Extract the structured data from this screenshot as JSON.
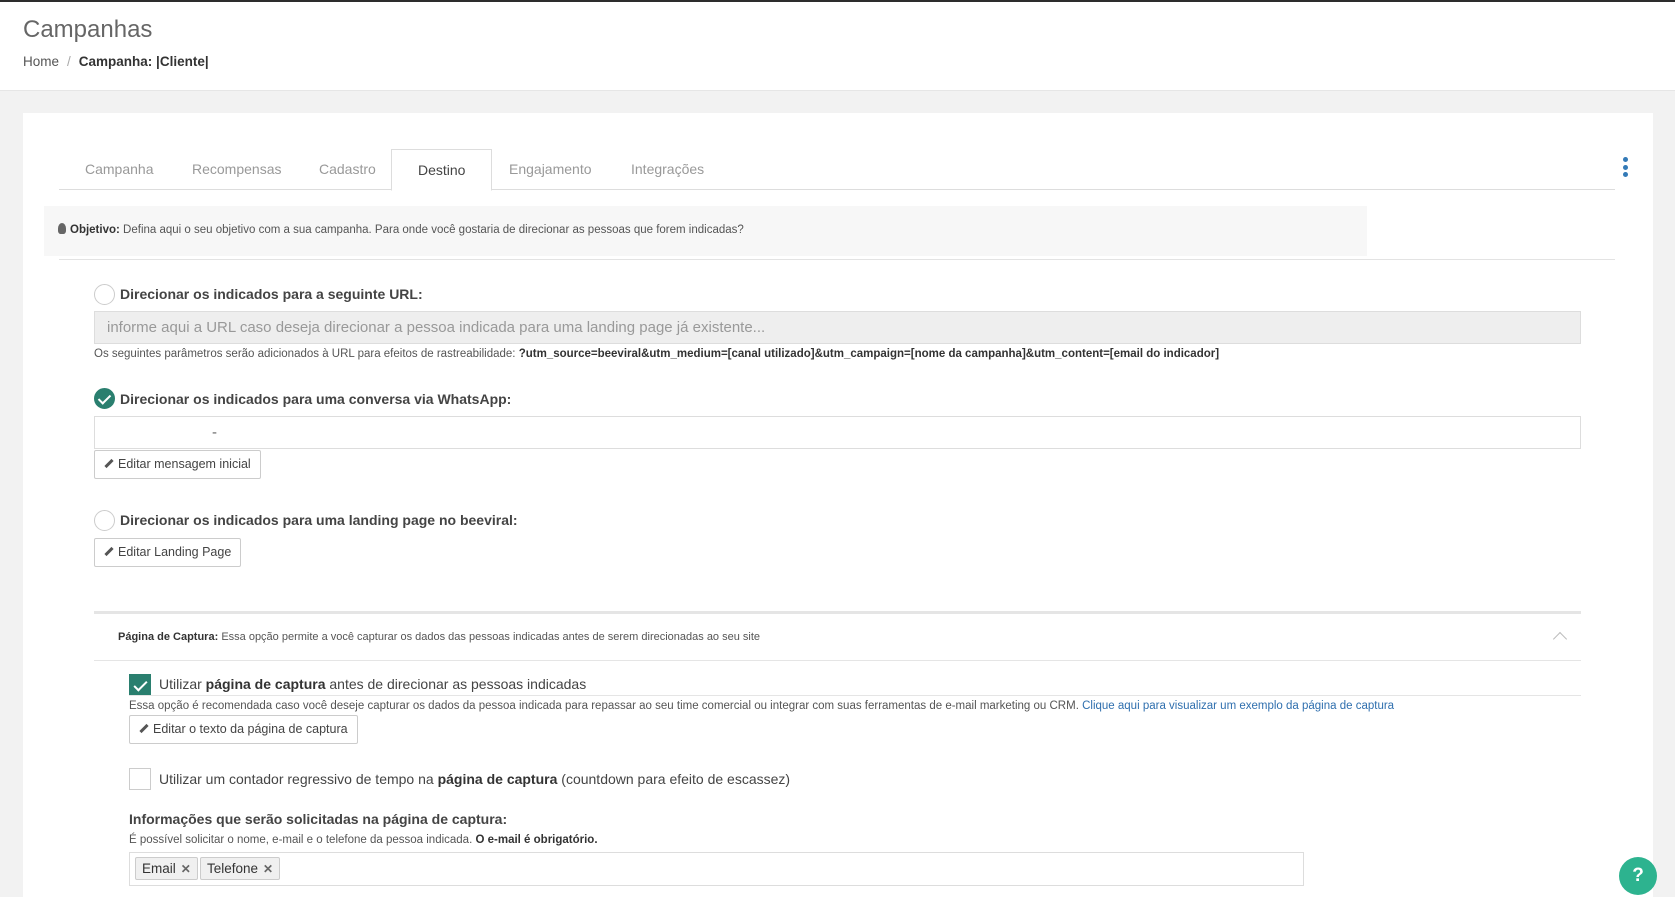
{
  "header": {
    "title": "Campanhas",
    "breadcrumb": {
      "home": "Home",
      "separator": "/",
      "current": "Campanha: |Cliente|"
    }
  },
  "tabs": [
    {
      "label": "Campanha",
      "active": false
    },
    {
      "label": "Recompensas",
      "active": false
    },
    {
      "label": "Cadastro",
      "active": false
    },
    {
      "label": "Destino",
      "active": true
    },
    {
      "label": "Engajamento",
      "active": false
    },
    {
      "label": "Integrações",
      "active": false
    }
  ],
  "objective": {
    "label": "Objetivo:",
    "text": "Defina aqui o seu objetivo com a sua campanha. Para onde você gostaria de direcionar as pessoas que forem indicadas?"
  },
  "options": {
    "url": {
      "label": "Direcionar os indicados para a seguinte URL:",
      "checked": false,
      "placeholder": "informe aqui a URL caso deseja direcionar a pessoa indicada para uma landing page já existente...",
      "help_prefix": "Os seguintes parâmetros serão adicionados à URL para efeitos de rastreabilidade:",
      "help_params": "?utm_source=beeviral&utm_medium=[canal utilizado]&utm_campaign=[nome da campanha]&utm_content=[email do indicador]"
    },
    "whatsapp": {
      "label": "Direcionar os indicados para uma conversa via WhatsApp:",
      "checked": true,
      "value": "-",
      "button": "Editar mensagem inicial"
    },
    "landing": {
      "label": "Direcionar os indicados para uma landing page no beeviral:",
      "checked": false,
      "button": "Editar Landing Page"
    }
  },
  "capture": {
    "label": "Página de Captura:",
    "text": "Essa opção permite a você capturar os dados das pessoas indicadas antes de serem direcionadas ao seu site",
    "use_capture": {
      "checked": true,
      "pre": "Utilizar",
      "bold": "página de captura",
      "post": "antes de direcionar as pessoas indicadas"
    },
    "recommendation": "Essa opção é recomendada caso você deseje capturar os dados da pessoa indicada para repassar ao seu time comercial ou integrar com suas ferramentas de e-mail marketing ou CRM.",
    "example_link": "Clique aqui para visualizar um exemplo da página de captura",
    "edit_button": "Editar o texto da página de captura",
    "countdown": {
      "checked": false,
      "pre": "Utilizar um contador regressivo de tempo na",
      "bold": "página de captura",
      "post": "(countdown para efeito de escassez)"
    },
    "fields_title": "Informações que serão solicitadas na página de captura:",
    "fields_help": "É possível solicitar o nome, e-mail e o telefone da pessoa indicada.",
    "fields_help_bold": "O e-mail é obrigatório.",
    "tags": [
      "Email",
      "Telefone"
    ]
  },
  "help_button": "?",
  "colors": {
    "accent": "#2a7f6f",
    "link": "#2f6fae",
    "help": "#2db38f"
  }
}
